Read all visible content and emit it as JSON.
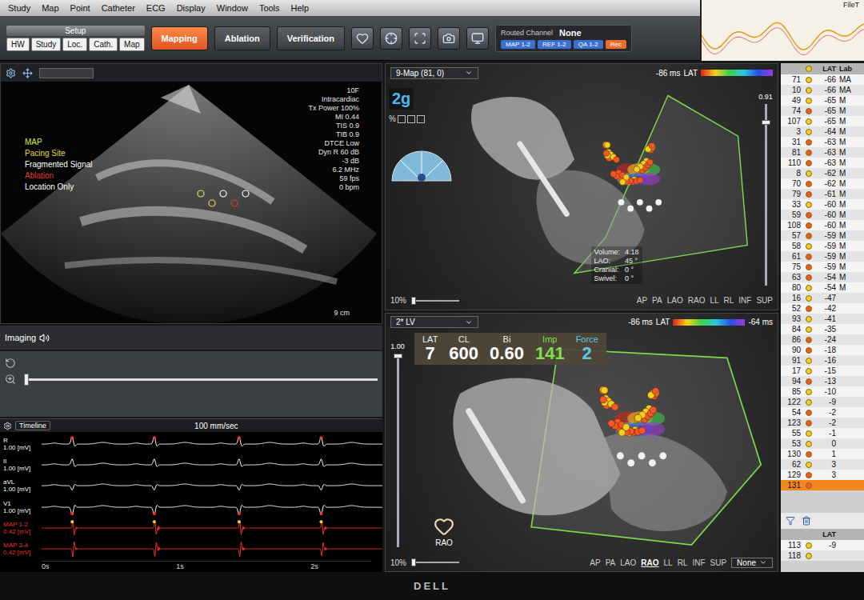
{
  "menu": [
    {
      "label": "Study"
    },
    {
      "label": "Map"
    },
    {
      "label": "Point"
    },
    {
      "label": "Catheter"
    },
    {
      "label": "ECG"
    },
    {
      "label": "Display"
    },
    {
      "label": "Window"
    },
    {
      "label": "Tools"
    },
    {
      "label": "Help"
    }
  ],
  "toolbar": {
    "setup_label": "Setup",
    "setup_tabs": [
      {
        "label": "HW",
        "selected": false
      },
      {
        "label": "Study",
        "selected": false
      },
      {
        "label": "Loc.",
        "selected": false
      },
      {
        "label": "Cath.",
        "selected": false
      },
      {
        "label": "Map",
        "selected": false
      }
    ],
    "modes": [
      {
        "label": "Mapping",
        "selected": true
      },
      {
        "label": "Ablation",
        "selected": false
      },
      {
        "label": "Verification",
        "selected": false
      }
    ],
    "routed_channel": {
      "label": "Routed Channel",
      "value": "None",
      "channels": [
        {
          "label": "MAP 1-2",
          "color": "#3b6fd0"
        },
        {
          "label": "REF 1-2",
          "color": "#3b6fd0"
        },
        {
          "label": "QA 1-2",
          "color": "#3b6fd0"
        },
        {
          "label": "Rec",
          "color": "#f06a2a"
        }
      ]
    }
  },
  "mini_ecg": {
    "title": "FileT"
  },
  "ultrasound": {
    "overlay": [
      "10F",
      "Intracardiac",
      "Tx Power 100%",
      "MI 0.44",
      "TIS 0.9",
      "TIB 0.9",
      "DTCE Low",
      "Dyn R 60 dB",
      "-3 dB",
      "6.2 MHz",
      "59 fps",
      "0 bpm"
    ],
    "legend": [
      {
        "label": "MAP",
        "color": "#d8e84a"
      },
      {
        "label": "Pacing Site",
        "color": "#e8d84a"
      },
      {
        "label": "Fragmented Signal",
        "color": "#ffffff"
      },
      {
        "label": "Ablation",
        "color": "#e03a2a"
      },
      {
        "label": "Location Only",
        "color": "#ffffff"
      }
    ],
    "depth": "9 cm",
    "imaging_label": "Imaging"
  },
  "ecg": {
    "speed": "100 mm/sec",
    "timeline": "Timeline",
    "duration_s": 2.45,
    "beat_times": [
      0.22,
      0.81,
      1.42,
      2.01
    ],
    "time_ticks": [
      {
        "label": "0s",
        "t": 0
      },
      {
        "label": "1s",
        "t": 1
      },
      {
        "label": "2s",
        "t": 2
      }
    ],
    "traces": [
      {
        "label": "R",
        "scale": "1.00 [mV]",
        "kind": "surface",
        "polarity": 1,
        "color": "#ffffff",
        "marked": true
      },
      {
        "label": "II",
        "scale": "1.00 [mV]",
        "kind": "surface",
        "polarity": 0.8,
        "color": "#ffffff",
        "marked": false
      },
      {
        "label": "aVL",
        "scale": "1.00 [mV]",
        "kind": "surface",
        "polarity": -0.6,
        "color": "#ffffff",
        "marked": false
      },
      {
        "label": "V1",
        "scale": "1.00 [mV]",
        "kind": "surface",
        "polarity": -1,
        "color": "#ffffff",
        "marked": true
      },
      {
        "label": "MAP 1-2",
        "scale": "0.42 [mV]",
        "kind": "intracardiac",
        "polarity": 1,
        "color": "#e8302a",
        "marked": true
      },
      {
        "label": "MAP 3-4",
        "scale": "0.42 [mV]",
        "kind": "intracardiac",
        "polarity": -1,
        "color": "#e8302a",
        "marked": false
      }
    ]
  },
  "map_top": {
    "title": "9-Map (81, 0)",
    "lat_min": "-86 ms",
    "lat_label": "LAT",
    "zoom": "2g",
    "percent": "%",
    "opacity": "0.91",
    "view_info": [
      {
        "label": "Volume:",
        "value": "4.18"
      },
      {
        "label": "LAO:",
        "value": "45 °"
      },
      {
        "label": "Cranial:",
        "value": "0 °"
      },
      {
        "label": "Swivel:",
        "value": "0 °"
      }
    ],
    "transparency": "10%",
    "views": [
      {
        "label": "AP",
        "selected": false
      },
      {
        "label": "PA",
        "selected": false
      },
      {
        "label": "LAO",
        "selected": false
      },
      {
        "label": "RAO",
        "selected": false
      },
      {
        "label": "LL",
        "selected": false
      },
      {
        "label": "RL",
        "selected": false
      },
      {
        "label": "INF",
        "selected": false
      },
      {
        "label": "SUP",
        "selected": false
      }
    ]
  },
  "map_bottom": {
    "title": "2* LV",
    "lat_min": "-86 ms",
    "lat_label": "LAT",
    "lat_max": "-64 ms",
    "readouts": [
      {
        "label": "LAT",
        "value": "7",
        "color": "#ffffff"
      },
      {
        "label": "CL",
        "value": "600",
        "color": "#ffffff"
      },
      {
        "label": "Bi",
        "value": "0.60",
        "color": "#ffffff"
      },
      {
        "label": "Imp",
        "value": "141",
        "color": "#7fe04a"
      },
      {
        "label": "Force",
        "value": "2",
        "color": "#5fc8e8"
      }
    ],
    "orientation": "RAO",
    "opacity": "1.00",
    "transparency": "10%",
    "dropdown": "None",
    "views": [
      {
        "label": "AP",
        "selected": false
      },
      {
        "label": "PA",
        "selected": false
      },
      {
        "label": "LAO",
        "selected": false
      },
      {
        "label": "RAO",
        "selected": true
      },
      {
        "label": "LL",
        "selected": false
      },
      {
        "label": "RL",
        "selected": false
      },
      {
        "label": "INF",
        "selected": false
      },
      {
        "label": "SUP",
        "selected": false
      }
    ]
  },
  "table": {
    "columns": [
      "LAT",
      "Lab"
    ],
    "rows": [
      {
        "id": "71",
        "lat": "-66",
        "lab": "MA",
        "color": "#f2cf1d",
        "selected": false
      },
      {
        "id": "10",
        "lat": "-66",
        "lab": "MA",
        "color": "#f2cf1d",
        "selected": false
      },
      {
        "id": "49",
        "lat": "-65",
        "lab": "M",
        "color": "#f2cf1d",
        "selected": false
      },
      {
        "id": "74",
        "lat": "-65",
        "lab": "M",
        "color": "#ef5a24",
        "selected": false
      },
      {
        "id": "107",
        "lat": "-65",
        "lab": "M",
        "color": "#f2cf1d",
        "selected": false
      },
      {
        "id": "3",
        "lat": "-64",
        "lab": "M",
        "color": "#f2cf1d",
        "selected": false
      },
      {
        "id": "31",
        "lat": "-63",
        "lab": "M",
        "color": "#ef5a24",
        "selected": false
      },
      {
        "id": "81",
        "lat": "-63",
        "lab": "M",
        "color": "#ef5a24",
        "selected": false
      },
      {
        "id": "110",
        "lat": "-63",
        "lab": "M",
        "color": "#ef5a24",
        "selected": false
      },
      {
        "id": "8",
        "lat": "-62",
        "lab": "M",
        "color": "#f2cf1d",
        "selected": false
      },
      {
        "id": "70",
        "lat": "-62",
        "lab": "M",
        "color": "#ef5a24",
        "selected": false
      },
      {
        "id": "79",
        "lat": "-61",
        "lab": "M",
        "color": "#ef5a24",
        "selected": false
      },
      {
        "id": "33",
        "lat": "-60",
        "lab": "M",
        "color": "#f2cf1d",
        "selected": false
      },
      {
        "id": "59",
        "lat": "-60",
        "lab": "M",
        "color": "#ef5a24",
        "selected": false
      },
      {
        "id": "108",
        "lat": "-60",
        "lab": "M",
        "color": "#ef5a24",
        "selected": false
      },
      {
        "id": "57",
        "lat": "-59",
        "lab": "M",
        "color": "#ef5a24",
        "selected": false
      },
      {
        "id": "58",
        "lat": "-59",
        "lab": "M",
        "color": "#f2cf1d",
        "selected": false
      },
      {
        "id": "61",
        "lat": "-59",
        "lab": "M",
        "color": "#ef5a24",
        "selected": false
      },
      {
        "id": "75",
        "lat": "-59",
        "lab": "M",
        "color": "#ef5a24",
        "selected": false
      },
      {
        "id": "63",
        "lat": "-54",
        "lab": "M",
        "color": "#ef5a24",
        "selected": false
      },
      {
        "id": "80",
        "lat": "-54",
        "lab": "M",
        "color": "#f2cf1d",
        "selected": false
      },
      {
        "id": "16",
        "lat": "-47",
        "lab": "",
        "color": "#f2cf1d",
        "selected": false
      },
      {
        "id": "52",
        "lat": "-42",
        "lab": "",
        "color": "#ef5a24",
        "selected": false
      },
      {
        "id": "93",
        "lat": "-41",
        "lab": "",
        "color": "#f2cf1d",
        "selected": false
      },
      {
        "id": "84",
        "lat": "-35",
        "lab": "",
        "color": "#f2cf1d",
        "selected": false
      },
      {
        "id": "86",
        "lat": "-24",
        "lab": "",
        "color": "#ef5a24",
        "selected": false
      },
      {
        "id": "90",
        "lat": "-18",
        "lab": "",
        "color": "#ef5a24",
        "selected": false
      },
      {
        "id": "91",
        "lat": "-16",
        "lab": "",
        "color": "#f2cf1d",
        "selected": false
      },
      {
        "id": "17",
        "lat": "-15",
        "lab": "",
        "color": "#f2cf1d",
        "selected": false
      },
      {
        "id": "94",
        "lat": "-13",
        "lab": "",
        "color": "#ef5a24",
        "selected": false
      },
      {
        "id": "85",
        "lat": "-10",
        "lab": "",
        "color": "#f2cf1d",
        "selected": false
      },
      {
        "id": "122",
        "lat": "-9",
        "lab": "",
        "color": "#f2cf1d",
        "selected": false
      },
      {
        "id": "54",
        "lat": "-2",
        "lab": "",
        "color": "#ef5a24",
        "selected": false
      },
      {
        "id": "123",
        "lat": "-2",
        "lab": "",
        "color": "#ef5a24",
        "selected": false
      },
      {
        "id": "55",
        "lat": "-1",
        "lab": "",
        "color": "#f2cf1d",
        "selected": false
      },
      {
        "id": "53",
        "lat": "0",
        "lab": "",
        "color": "#f2cf1d",
        "selected": false
      },
      {
        "id": "130",
        "lat": "1",
        "lab": "",
        "color": "#ef5a24",
        "selected": false
      },
      {
        "id": "62",
        "lat": "3",
        "lab": "",
        "color": "#f2cf1d",
        "selected": false
      },
      {
        "id": "129",
        "lat": "3",
        "lab": "",
        "color": "#ef5a24",
        "selected": false
      },
      {
        "id": "131",
        "lat": "",
        "lab": "",
        "color": "#ef5a24",
        "selected": true
      }
    ],
    "bottom_columns": [
      "LAT"
    ],
    "bottom_rows": [
      {
        "id": "113",
        "lat": "-9",
        "color": "#f2cf1d"
      },
      {
        "id": "118",
        "lat": "",
        "color": "#f2cf1d"
      }
    ]
  },
  "bezel": {
    "logo": "DELL"
  }
}
